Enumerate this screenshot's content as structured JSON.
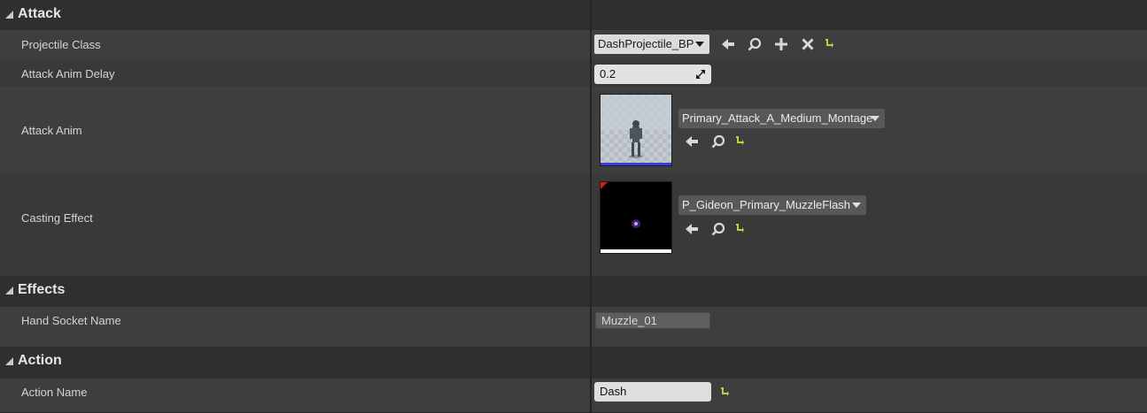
{
  "sections": {
    "attack": {
      "title": "Attack"
    },
    "effects": {
      "title": "Effects"
    },
    "action": {
      "title": "Action"
    }
  },
  "properties": {
    "projectile_class": {
      "label": "Projectile Class",
      "value": "DashProjectile_BP"
    },
    "attack_anim_delay": {
      "label": "Attack Anim Delay",
      "value": "0.2"
    },
    "attack_anim": {
      "label": "Attack Anim",
      "value": "Primary_Attack_A_Medium_Montage"
    },
    "casting_effect": {
      "label": "Casting Effect",
      "value": "P_Gideon_Primary_MuzzleFlash"
    },
    "hand_socket_name": {
      "label": "Hand Socket Name",
      "value": "Muzzle_01"
    },
    "action_name": {
      "label": "Action Name",
      "value": "Dash"
    }
  },
  "colors": {
    "reset_arrow": "#c9c940",
    "icon_white": "#d8d8d8"
  },
  "icons": [
    "browse-arrow-icon",
    "search-icon",
    "add-icon",
    "clear-icon",
    "reset-default-icon"
  ]
}
